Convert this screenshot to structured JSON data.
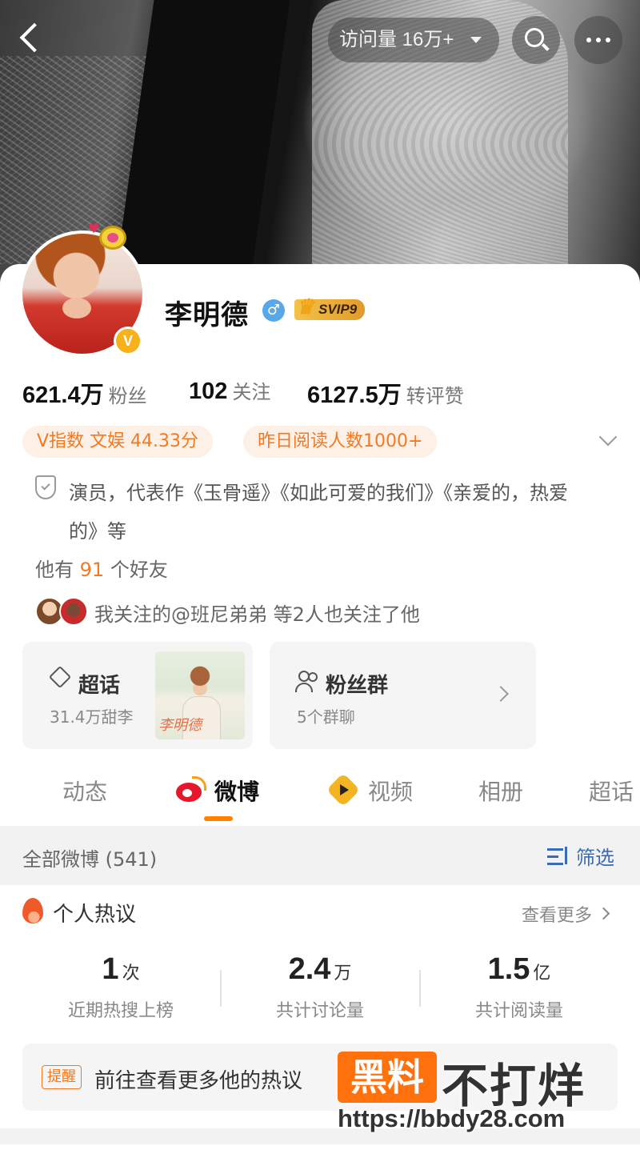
{
  "topbar": {
    "visits_label": "访问量 16万+"
  },
  "profile": {
    "name": "李明德",
    "gender_symbol": "♂",
    "vip_badge": "SVIP9",
    "verified_mark": "V",
    "stats": [
      {
        "value": "621.4万",
        "label": "粉丝"
      },
      {
        "value": "102",
        "label": "关注"
      },
      {
        "value": "6127.5万",
        "label": "转评赞"
      }
    ],
    "chips": [
      "V指数 文娱 44.33分",
      "昨日阅读人数1000+"
    ],
    "bio": "演员，代表作《玉骨遥》《如此可爱的我们》《亲爱的，热爱的》等",
    "friends_prefix": "他有",
    "friends_count": "91",
    "friends_suffix": "个好友",
    "mutual_text": "我关注的@班尼弟弟 等2人也关注了他"
  },
  "tiles": {
    "super": {
      "title": "超话",
      "subtitle": "31.4万甜李",
      "thumb_caption": "李明德"
    },
    "fans": {
      "title": "粉丝群",
      "subtitle": "5个群聊"
    }
  },
  "tabs": [
    "动态",
    "微博",
    "视频",
    "相册",
    "超话"
  ],
  "active_tab": "微博",
  "filter": {
    "title": "全部微博 (541)",
    "button": "筛选"
  },
  "hot": {
    "title": "个人热议",
    "more": "查看更多",
    "metrics": [
      {
        "value": "1",
        "unit": "次",
        "label": "近期热搜上榜"
      },
      {
        "value": "2.4",
        "unit": "万",
        "label": "共计讨论量"
      },
      {
        "value": "1.5",
        "unit": "亿",
        "label": "共计阅读量"
      }
    ],
    "remind_tag": "提醒",
    "remind_text": "前往查看更多他的热议"
  },
  "watermark": {
    "logo": "黑料",
    "text": "不打烊",
    "url": "https://bbdy28.com"
  },
  "colors": {
    "accent_orange": "#ff8200",
    "chip_text": "#f17a23",
    "link_blue": "#3a6bb5"
  }
}
